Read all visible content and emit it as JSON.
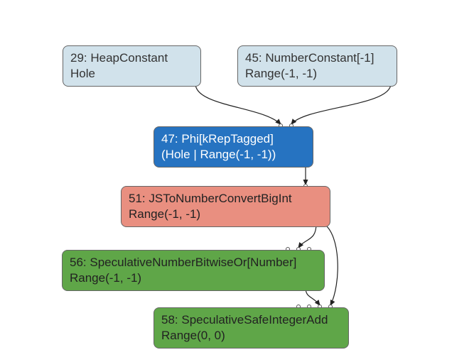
{
  "nodes": {
    "n29": {
      "id": "29",
      "label": "HeapConstant",
      "detail": "Hole"
    },
    "n45": {
      "id": "45",
      "label": "NumberConstant[-1]",
      "detail": "Range(-1, -1)"
    },
    "n47": {
      "id": "47",
      "label": "Phi[kRepTagged]",
      "detail": "(Hole | Range(-1, -1))"
    },
    "n51": {
      "id": "51",
      "label": "JSToNumberConvertBigInt",
      "detail": "Range(-1, -1)"
    },
    "n56": {
      "id": "56",
      "label": "SpeculativeNumberBitwiseOr[Number]",
      "detail": "Range(-1, -1)"
    },
    "n58": {
      "id": "58",
      "label": "SpeculativeSafeIntegerAdd",
      "detail": "Range(0, 0)"
    }
  },
  "edges": [
    {
      "from": "n29",
      "to": "n47"
    },
    {
      "from": "n45",
      "to": "n47"
    },
    {
      "from": "n47",
      "to": "n51"
    },
    {
      "from": "n51",
      "to": "n56"
    },
    {
      "from": "n51",
      "to": "n58"
    },
    {
      "from": "n56",
      "to": "n58"
    }
  ]
}
